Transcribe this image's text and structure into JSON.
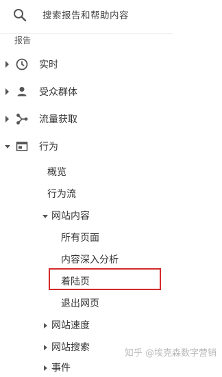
{
  "search": {
    "placeholder": "搜索报告和帮助内容"
  },
  "section": {
    "label": "报告"
  },
  "nav": {
    "realtime": "实时",
    "audience": "受众群体",
    "acquisition": "流量获取",
    "behavior": "行为"
  },
  "behavior_items": {
    "overview": "概览",
    "flow": "行为流",
    "site_content": "网站内容",
    "all_pages": "所有页面",
    "drilldown": "内容深入分析",
    "landing": "着陆页",
    "exit": "退出网页",
    "speed": "网站速度",
    "search": "网站搜索",
    "events": "事件"
  },
  "watermark": "知乎 @埃克森数字营销",
  "colors": {
    "highlight": "#d42a2a",
    "icon": "#555555"
  }
}
